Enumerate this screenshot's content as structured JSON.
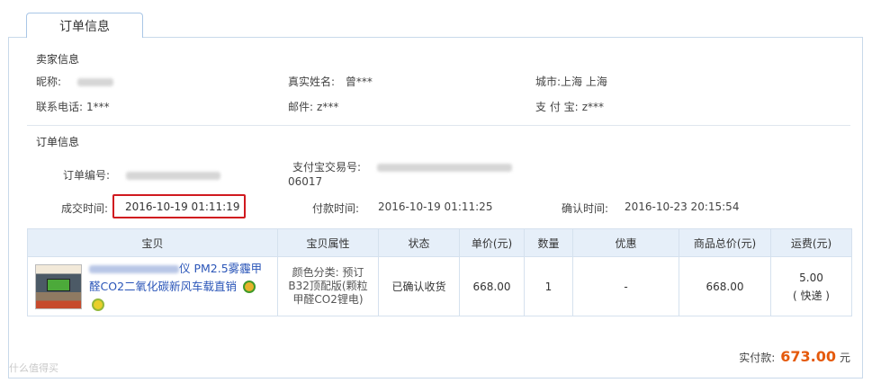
{
  "tab": {
    "label": "订单信息"
  },
  "seller": {
    "title": "卖家信息",
    "nickname_label": "昵称:",
    "realname_label": "真实姓名:",
    "realname_value": "曾***",
    "city_label": "城市:",
    "city_value": "上海 上海",
    "phone_label": "联系电话:",
    "phone_value": "1***",
    "email_label": "邮件:",
    "email_value": "z***",
    "alipay_label": "支 付 宝:",
    "alipay_value": "z***"
  },
  "order": {
    "title": "订单信息",
    "order_no_label": "订单编号:",
    "alipay_trade_label": "支付宝交易号:",
    "alipay_trade_tail": "06017",
    "deal_time_label": "成交时间:",
    "deal_time_value": "2016-10-19 01:11:19",
    "pay_time_label": "付款时间:",
    "pay_time_value": "2016-10-19 01:11:25",
    "confirm_time_label": "确认时间:",
    "confirm_time_value": "2016-10-23 20:15:54"
  },
  "table": {
    "headers": [
      "宝贝",
      "宝贝属性",
      "状态",
      "单价(元)",
      "数量",
      "优惠",
      "商品总价(元)",
      "运费(元)"
    ],
    "row": {
      "title_visible": "仪 PM2.5雾霾甲醛CO2二氧化碳新风车载直销",
      "attr": "颜色分类: 预订B32顶配版(颗粒甲醛CO2锂电)",
      "status": "已确认收货",
      "unit_price": "668.00",
      "quantity": "1",
      "discount": "-",
      "total": "668.00",
      "shipping": "5.00",
      "shipping_method": "( 快递 )"
    }
  },
  "summary": {
    "paid_label": "实付款:",
    "paid_amount": "673.00",
    "currency": "元"
  },
  "watermark": "什么值得买",
  "colors": {
    "accent_orange": "#e55a0c",
    "link_blue": "#2a55b8",
    "highlight_red": "#d0191f"
  }
}
